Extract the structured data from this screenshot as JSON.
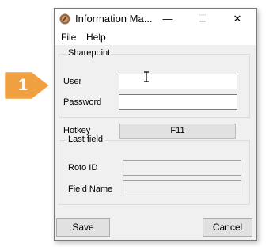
{
  "callout": {
    "number": "1",
    "color": "#f0a040"
  },
  "window": {
    "title": "Information Ma...",
    "controls": {
      "minimize": "—",
      "maximize": "☐",
      "close": "✕"
    }
  },
  "menu": {
    "file": "File",
    "help": "Help"
  },
  "sharepoint": {
    "legend": "Sharepoint",
    "user_label": "User",
    "user_value": "",
    "password_label": "Password",
    "password_value": ""
  },
  "hotkey": {
    "label": "Hotkey",
    "value": "F11"
  },
  "last_field": {
    "legend": "Last field",
    "roto_id_label": "Roto ID",
    "roto_id_value": "",
    "field_name_label": "Field Name",
    "field_name_value": ""
  },
  "buttons": {
    "save": "Save",
    "cancel": "Cancel"
  }
}
